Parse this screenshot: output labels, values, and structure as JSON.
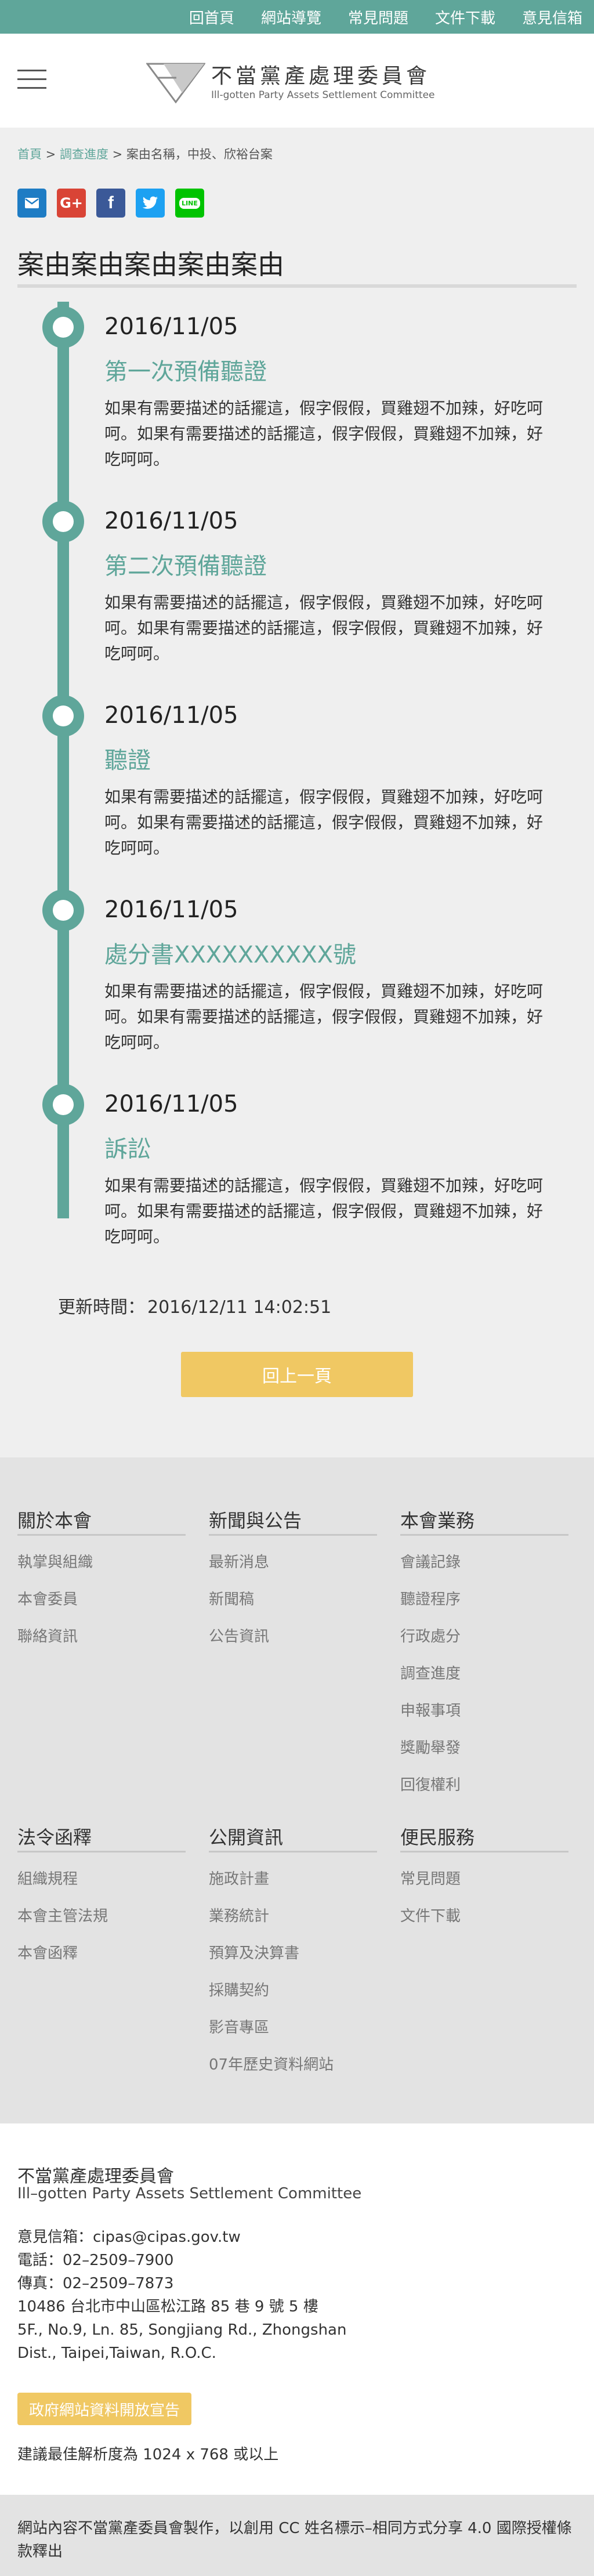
{
  "topnav": {
    "items": [
      "回首頁",
      "網站導覽",
      "常見問題",
      "文件下載",
      "意見信箱"
    ]
  },
  "header": {
    "logo_zh": "不當黨產處理委員會",
    "logo_en": "Ill-gotten Party Assets Settlement Committee"
  },
  "breadcrumb": {
    "home": "首頁",
    "sep1": " > ",
    "section": "調查進度",
    "sep2": " > ",
    "current": "案由名稱，中投、欣裕台案"
  },
  "share": {
    "icons": [
      "mail-icon",
      "google-plus-icon",
      "facebook-icon",
      "twitter-icon",
      "line-icon"
    ],
    "gplus_label": "G+",
    "fb_label": "f",
    "line_label": "LINE"
  },
  "page": {
    "title": "案由案由案由案由案由"
  },
  "timeline": [
    {
      "date": "2016/11/05",
      "heading": "第一次預備聽證",
      "body": "如果有需要描述的話擺這，假字假假，買雞翅不加辣，好吃呵呵。如果有需要描述的話擺這，假字假假，買雞翅不加辣，好吃呵呵。"
    },
    {
      "date": "2016/11/05",
      "heading": "第二次預備聽證",
      "body": "如果有需要描述的話擺這，假字假假，買雞翅不加辣，好吃呵呵。如果有需要描述的話擺這，假字假假，買雞翅不加辣，好吃呵呵。"
    },
    {
      "date": "2016/11/05",
      "heading": "聽證",
      "body": "如果有需要描述的話擺這，假字假假，買雞翅不加辣，好吃呵呵。如果有需要描述的話擺這，假字假假，買雞翅不加辣，好吃呵呵。"
    },
    {
      "date": "2016/11/05",
      "heading": "處分書XXXXXXXXXX號",
      "body": "如果有需要描述的話擺這，假字假假，買雞翅不加辣，好吃呵呵。如果有需要描述的話擺這，假字假假，買雞翅不加辣，好吃呵呵。"
    },
    {
      "date": "2016/11/05",
      "heading": "訴訟",
      "body": "如果有需要描述的話擺這，假字假假，買雞翅不加辣，好吃呵呵。如果有需要描述的話擺這，假字假假，買雞翅不加辣，好吃呵呵。"
    }
  ],
  "updated": {
    "label": "更新時間：",
    "value": "2016/12/11 14:02:51"
  },
  "back_button": "回上一頁",
  "sitemap": [
    {
      "title": "關於本會",
      "items": [
        "執掌與組織",
        "本會委員",
        "聯絡資訊"
      ]
    },
    {
      "title": "新聞與公告",
      "items": [
        "最新消息",
        "新聞稿",
        "公告資訊"
      ]
    },
    {
      "title": "本會業務",
      "items": [
        "會議記錄",
        "聽證程序",
        "行政處分",
        "調查進度",
        "申報事項",
        "獎勵舉發",
        "回復權利"
      ]
    },
    {
      "title": "法令函釋",
      "items": [
        "組織規程",
        "本會主管法規",
        "本會函釋"
      ]
    },
    {
      "title": "公開資訊",
      "items": [
        "施政計畫",
        "業務統計",
        "預算及決算書",
        "採購契約",
        "影音專區",
        "07年歷史資料網站"
      ]
    },
    {
      "title": "便民服務",
      "items": [
        "常見問題",
        "文件下載"
      ]
    }
  ],
  "footer": {
    "org_zh": "不當黨產處理委員會",
    "org_en": "Ill–gotten Party Assets Settlement Committee",
    "email": "意見信箱：cipas@cipas.gov.tw",
    "phone": "電話：02–2509–7900",
    "fax": "傳真：02–2509–7873",
    "address_zh": "10486 台北市中山區松江路 85 巷 9 號 5 樓",
    "address_en_1": "5F., No.9, Ln. 85, Songjiang Rd., Zhongshan",
    "address_en_2": "Dist., Taipei,Taiwan, R.O.C.",
    "open_data": "政府網站資料開放宣告",
    "resolution": "建議最佳解析度為 1024 x 768 或以上",
    "copyright": "網站內容不當黨產委員會製作，以創用 CC 姓名標示–相同方式分享 4.0 國際授權條款釋出"
  }
}
